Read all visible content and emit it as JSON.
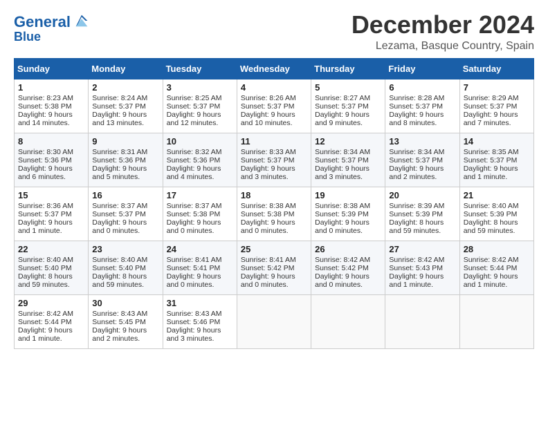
{
  "header": {
    "logo_line1": "General",
    "logo_line2": "Blue",
    "month": "December 2024",
    "location": "Lezama, Basque Country, Spain"
  },
  "weekdays": [
    "Sunday",
    "Monday",
    "Tuesday",
    "Wednesday",
    "Thursday",
    "Friday",
    "Saturday"
  ],
  "weeks": [
    [
      {
        "day": "1",
        "lines": [
          "Sunrise: 8:23 AM",
          "Sunset: 5:38 PM",
          "Daylight: 9 hours",
          "and 14 minutes."
        ]
      },
      {
        "day": "2",
        "lines": [
          "Sunrise: 8:24 AM",
          "Sunset: 5:37 PM",
          "Daylight: 9 hours",
          "and 13 minutes."
        ]
      },
      {
        "day": "3",
        "lines": [
          "Sunrise: 8:25 AM",
          "Sunset: 5:37 PM",
          "Daylight: 9 hours",
          "and 12 minutes."
        ]
      },
      {
        "day": "4",
        "lines": [
          "Sunrise: 8:26 AM",
          "Sunset: 5:37 PM",
          "Daylight: 9 hours",
          "and 10 minutes."
        ]
      },
      {
        "day": "5",
        "lines": [
          "Sunrise: 8:27 AM",
          "Sunset: 5:37 PM",
          "Daylight: 9 hours",
          "and 9 minutes."
        ]
      },
      {
        "day": "6",
        "lines": [
          "Sunrise: 8:28 AM",
          "Sunset: 5:37 PM",
          "Daylight: 9 hours",
          "and 8 minutes."
        ]
      },
      {
        "day": "7",
        "lines": [
          "Sunrise: 8:29 AM",
          "Sunset: 5:37 PM",
          "Daylight: 9 hours",
          "and 7 minutes."
        ]
      }
    ],
    [
      {
        "day": "8",
        "lines": [
          "Sunrise: 8:30 AM",
          "Sunset: 5:36 PM",
          "Daylight: 9 hours",
          "and 6 minutes."
        ]
      },
      {
        "day": "9",
        "lines": [
          "Sunrise: 8:31 AM",
          "Sunset: 5:36 PM",
          "Daylight: 9 hours",
          "and 5 minutes."
        ]
      },
      {
        "day": "10",
        "lines": [
          "Sunrise: 8:32 AM",
          "Sunset: 5:36 PM",
          "Daylight: 9 hours",
          "and 4 minutes."
        ]
      },
      {
        "day": "11",
        "lines": [
          "Sunrise: 8:33 AM",
          "Sunset: 5:37 PM",
          "Daylight: 9 hours",
          "and 3 minutes."
        ]
      },
      {
        "day": "12",
        "lines": [
          "Sunrise: 8:34 AM",
          "Sunset: 5:37 PM",
          "Daylight: 9 hours",
          "and 3 minutes."
        ]
      },
      {
        "day": "13",
        "lines": [
          "Sunrise: 8:34 AM",
          "Sunset: 5:37 PM",
          "Daylight: 9 hours",
          "and 2 minutes."
        ]
      },
      {
        "day": "14",
        "lines": [
          "Sunrise: 8:35 AM",
          "Sunset: 5:37 PM",
          "Daylight: 9 hours",
          "and 1 minute."
        ]
      }
    ],
    [
      {
        "day": "15",
        "lines": [
          "Sunrise: 8:36 AM",
          "Sunset: 5:37 PM",
          "Daylight: 9 hours",
          "and 1 minute."
        ]
      },
      {
        "day": "16",
        "lines": [
          "Sunrise: 8:37 AM",
          "Sunset: 5:37 PM",
          "Daylight: 9 hours",
          "and 0 minutes."
        ]
      },
      {
        "day": "17",
        "lines": [
          "Sunrise: 8:37 AM",
          "Sunset: 5:38 PM",
          "Daylight: 9 hours",
          "and 0 minutes."
        ]
      },
      {
        "day": "18",
        "lines": [
          "Sunrise: 8:38 AM",
          "Sunset: 5:38 PM",
          "Daylight: 9 hours",
          "and 0 minutes."
        ]
      },
      {
        "day": "19",
        "lines": [
          "Sunrise: 8:38 AM",
          "Sunset: 5:39 PM",
          "Daylight: 9 hours",
          "and 0 minutes."
        ]
      },
      {
        "day": "20",
        "lines": [
          "Sunrise: 8:39 AM",
          "Sunset: 5:39 PM",
          "Daylight: 8 hours",
          "and 59 minutes."
        ]
      },
      {
        "day": "21",
        "lines": [
          "Sunrise: 8:40 AM",
          "Sunset: 5:39 PM",
          "Daylight: 8 hours",
          "and 59 minutes."
        ]
      }
    ],
    [
      {
        "day": "22",
        "lines": [
          "Sunrise: 8:40 AM",
          "Sunset: 5:40 PM",
          "Daylight: 8 hours",
          "and 59 minutes."
        ]
      },
      {
        "day": "23",
        "lines": [
          "Sunrise: 8:40 AM",
          "Sunset: 5:40 PM",
          "Daylight: 8 hours",
          "and 59 minutes."
        ]
      },
      {
        "day": "24",
        "lines": [
          "Sunrise: 8:41 AM",
          "Sunset: 5:41 PM",
          "Daylight: 9 hours",
          "and 0 minutes."
        ]
      },
      {
        "day": "25",
        "lines": [
          "Sunrise: 8:41 AM",
          "Sunset: 5:42 PM",
          "Daylight: 9 hours",
          "and 0 minutes."
        ]
      },
      {
        "day": "26",
        "lines": [
          "Sunrise: 8:42 AM",
          "Sunset: 5:42 PM",
          "Daylight: 9 hours",
          "and 0 minutes."
        ]
      },
      {
        "day": "27",
        "lines": [
          "Sunrise: 8:42 AM",
          "Sunset: 5:43 PM",
          "Daylight: 9 hours",
          "and 1 minute."
        ]
      },
      {
        "day": "28",
        "lines": [
          "Sunrise: 8:42 AM",
          "Sunset: 5:44 PM",
          "Daylight: 9 hours",
          "and 1 minute."
        ]
      }
    ],
    [
      {
        "day": "29",
        "lines": [
          "Sunrise: 8:42 AM",
          "Sunset: 5:44 PM",
          "Daylight: 9 hours",
          "and 1 minute."
        ]
      },
      {
        "day": "30",
        "lines": [
          "Sunrise: 8:43 AM",
          "Sunset: 5:45 PM",
          "Daylight: 9 hours",
          "and 2 minutes."
        ]
      },
      {
        "day": "31",
        "lines": [
          "Sunrise: 8:43 AM",
          "Sunset: 5:46 PM",
          "Daylight: 9 hours",
          "and 3 minutes."
        ]
      },
      null,
      null,
      null,
      null
    ]
  ]
}
